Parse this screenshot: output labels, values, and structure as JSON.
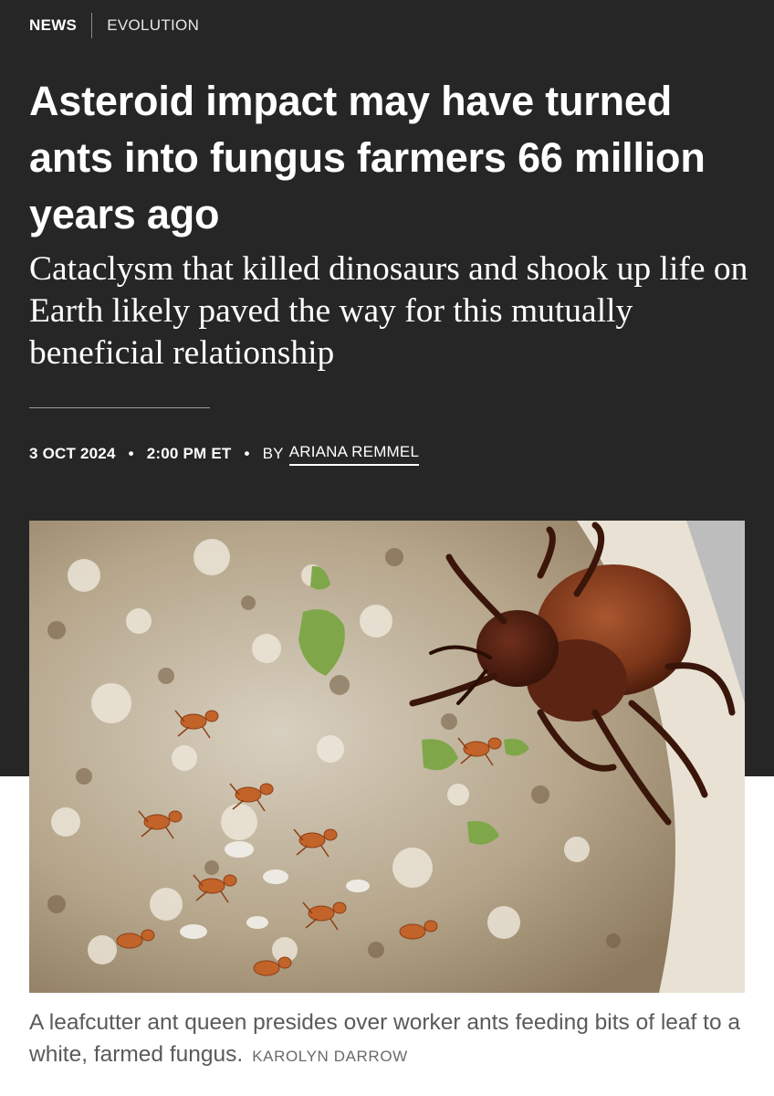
{
  "breadcrumb": {
    "category": "NEWS",
    "section": "EVOLUTION"
  },
  "article": {
    "headline": "Asteroid impact may have turned ants into fungus farmers 66 million years ago",
    "dek": "Cataclysm that killed dinosaurs and shook up life on Earth likely paved the way for this mutually beneficial relationship",
    "date": "3 OCT 2024",
    "time": "2:00 PM ET",
    "byline_prefix": "BY",
    "author": "ARIANA REMMEL",
    "separator": "•"
  },
  "image": {
    "caption": "A leafcutter ant queen presides over worker ants feeding bits of leaf to a white, farmed fungus.",
    "credit": "KAROLYN DARROW"
  },
  "colors": {
    "header_background": "#262626",
    "header_text": "#ffffff",
    "caption_text": "#5a5a5a"
  }
}
